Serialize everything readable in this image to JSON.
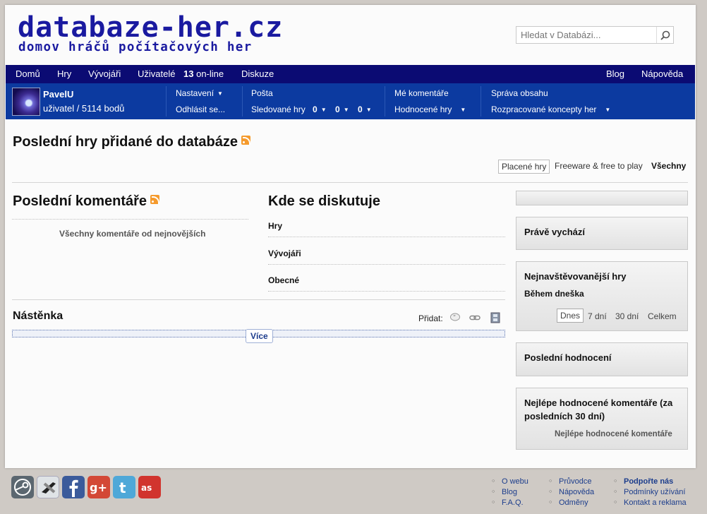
{
  "header": {
    "logo_title": "databaze-her.cz",
    "logo_subtitle": "domov hráčů počítačových her",
    "search_placeholder": "Hledat v Databázi...",
    "search_icon": "search-icon"
  },
  "nav": {
    "home": "Domů",
    "games": "Hry",
    "developers": "Vývojáři",
    "users": "Uživatelé",
    "online_count": "13",
    "online_label": "on-line",
    "discussion": "Diskuze",
    "blog": "Blog",
    "help": "Nápověda"
  },
  "userbar": {
    "username": "PavelU",
    "rank": "uživatel / 5114 bodů",
    "settings": "Nastavení",
    "logout": "Odhlásit se...",
    "mail": "Pošta",
    "followed_games": "Sledované hry",
    "count1": "0",
    "count2": "0",
    "count3": "0",
    "my_comments": "Mé komentáře",
    "rated_games": "Hodnocené hry",
    "content_admin": "Správa obsahu",
    "drafts": "Rozpracované koncepty her"
  },
  "main": {
    "latest_games_title": "Poslední hry přidané do databáze",
    "filters": [
      "Placené hry",
      "Freeware & free to play",
      "Všechny"
    ],
    "latest_comments_title": "Poslední komentáře",
    "all_comments_link": "Všechny komentáře od nejnovějších",
    "discussion_title": "Kde se diskutuje",
    "discussion_items": [
      "Hry",
      "Vývojáři",
      "Obecné"
    ],
    "wall_title": "Nástěnka",
    "add_label": "Přidat:",
    "more_button": "Více"
  },
  "sidebar": {
    "now_releasing": "Právě vychází",
    "most_visited": "Nejnavštěvovanější hry",
    "today": "Během dneška",
    "periods": [
      "Dnes",
      "7 dní",
      "30 dní",
      "Celkem"
    ],
    "latest_ratings": "Poslední hodnocení",
    "best_comments_title": "Nejlépe hodnocené komentáře (za posledních 30 dní)",
    "best_comments_link": "Nejlépe hodnocené komentáře"
  },
  "footer": {
    "social": [
      "steam-icon",
      "xfire-icon",
      "facebook-icon",
      "google-plus-icon",
      "twitter-icon",
      "lastfm-icon"
    ],
    "col1": [
      "O webu",
      "Blog",
      "F.A.Q."
    ],
    "col2": [
      "Průvodce",
      "Nápověda",
      "Odměny"
    ],
    "col3": [
      "Podpořte nás",
      "Podmínky užívání",
      "Kontakt a reklama"
    ]
  },
  "colors": {
    "nav_bg": "#0b0b73",
    "userbar_bg": "#0c3aa0",
    "logo": "#1a1aa0",
    "rss": "#f59a2c"
  }
}
